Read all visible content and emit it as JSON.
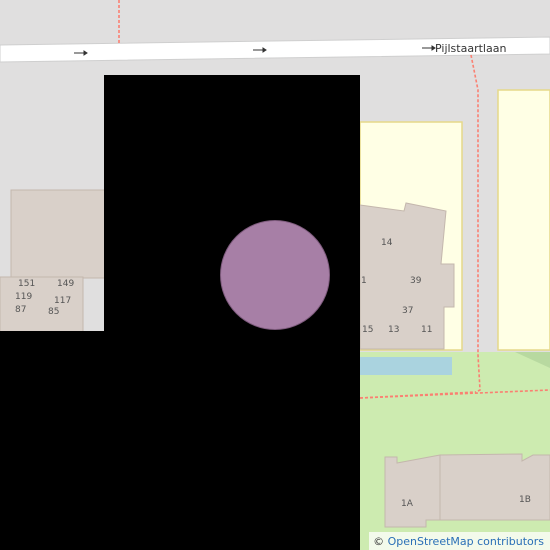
{
  "street": {
    "name": "Pijlstaartlaan"
  },
  "house_numbers": {
    "n14": "14",
    "n11_partial": "1",
    "n39": "39",
    "n37": "37",
    "n15": "15",
    "n13": "13",
    "n11": "11",
    "n151": "151",
    "n149": "149",
    "n119": "119",
    "n117": "117",
    "n87": "87",
    "n85": "85",
    "n1a": "1A",
    "n1b": "1B"
  },
  "attribution": {
    "symbol": "©",
    "text": "OpenStreetMap contributors"
  },
  "marker": {
    "color": "#a77fa6"
  },
  "colors": {
    "road": "#ffffff",
    "building": "#d9d0c9",
    "residential": "#e0dfdf",
    "park": "#cdebb0",
    "school": "#ffffe5",
    "water": "#aad3df",
    "path": "#fa8072",
    "mask": "#000000"
  }
}
